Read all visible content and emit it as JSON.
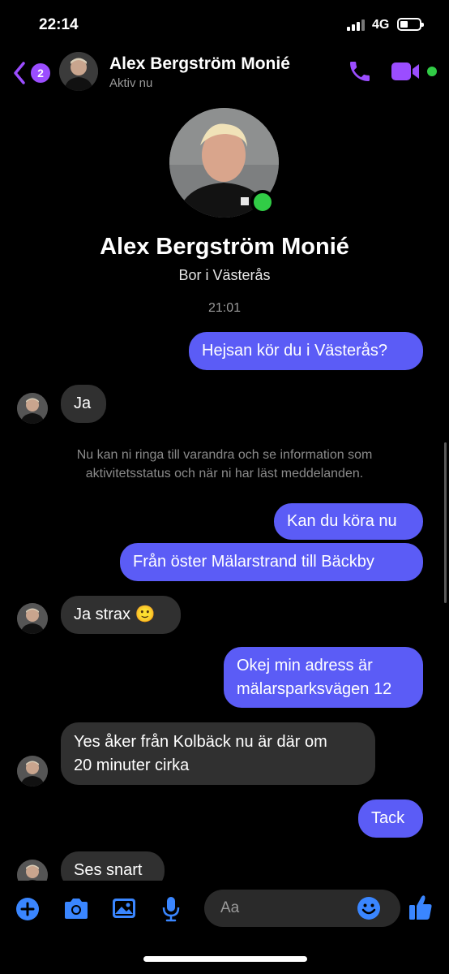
{
  "status_bar": {
    "time": "22:14",
    "network": "4G"
  },
  "header": {
    "back_badge": "2",
    "contact_name": "Alex Bergström Monié",
    "contact_status": "Aktiv nu"
  },
  "profile": {
    "name": "Alex Bergström Monié",
    "subtitle": "Bor i Västerås",
    "timestamp": "21:01"
  },
  "messages": [
    {
      "dir": "out",
      "text": "Hejsan kör du i Västerås?"
    },
    {
      "dir": "in",
      "text": "Ja"
    },
    {
      "dir": "info",
      "lines": [
        "Nu kan ni ringa till varandra och se information som",
        "aktivitetsstatus och när ni har läst meddelanden."
      ]
    },
    {
      "dir": "out",
      "text": "Kan du köra nu"
    },
    {
      "dir": "out",
      "text": "Från öster Mälarstrand till Bäckby"
    },
    {
      "dir": "in",
      "text": "Ja strax 🙂"
    },
    {
      "dir": "out",
      "lines": [
        "Okej min adress är",
        "mälarsparksvägen 12"
      ]
    },
    {
      "dir": "in",
      "lines": [
        "Yes åker från Kolbäck nu är där om",
        "20 minuter cirka"
      ]
    },
    {
      "dir": "out",
      "text": "Tack"
    },
    {
      "dir": "in",
      "text": "Ses snart"
    }
  ],
  "composer": {
    "placeholder": "Aa"
  },
  "colors": {
    "accent": "#9b4dff",
    "outgoing_bubble": "#5b5cf6",
    "incoming_bubble": "#303030",
    "online": "#31cc46",
    "composer_icons": "#3a86ff"
  },
  "icons": [
    "phone-icon",
    "video-camera-icon",
    "plus-icon",
    "camera-icon",
    "image-icon",
    "microphone-icon",
    "emoji-icon",
    "thumbs-up-icon"
  ]
}
